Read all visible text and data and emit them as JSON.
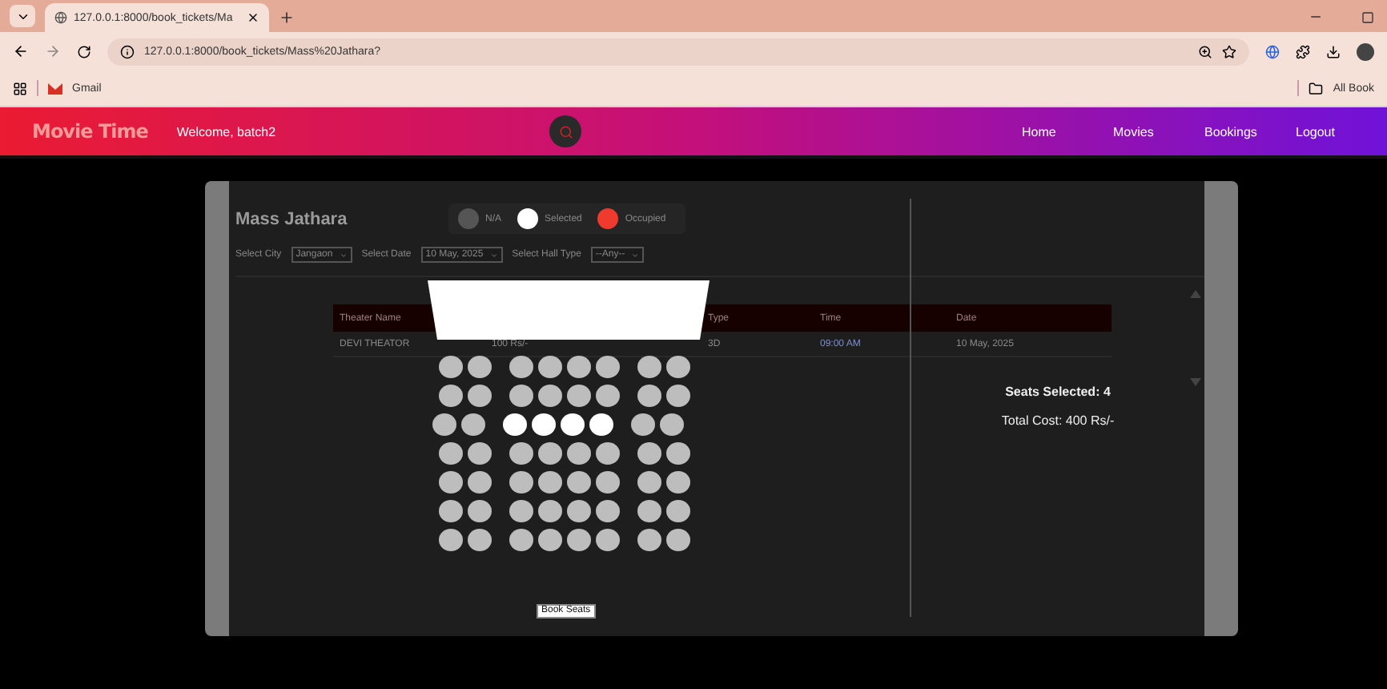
{
  "browser": {
    "tab_title": "127.0.0.1:8000/book_tickets/Ma",
    "address": "127.0.0.1:8000/book_tickets/Mass%20Jathara?",
    "bookmarks": [
      "Gmail"
    ],
    "all_bookmarks": "All Book"
  },
  "navbar": {
    "brand": "Movie Time",
    "welcome": "Welcome, batch2",
    "links": [
      "Home",
      "Movies",
      "Bookings",
      "Logout"
    ]
  },
  "movie": {
    "title": "Mass Jathara"
  },
  "legend": [
    {
      "label": "N/A",
      "color": "#555555"
    },
    {
      "label": "Selected",
      "color": "#ffffff"
    },
    {
      "label": "Occupied",
      "color": "#f03a2e"
    }
  ],
  "filters": [
    {
      "label": "Select City",
      "value": "Jangaon"
    },
    {
      "label": "Select Date",
      "value": "10 May, 2025"
    },
    {
      "label": "Select Hall Type",
      "value": "--Any--"
    }
  ],
  "table": {
    "columns": [
      {
        "label": "Theater Name"
      },
      {},
      {},
      {
        "label": "Type"
      },
      {
        "label": "Time"
      },
      {
        "label": "Date"
      }
    ],
    "rows": [
      {
        "cells": [
          "DEVI THEATOR",
          "100 Rs/-",
          "",
          "3D",
          "09:00 AM",
          "10 May, 2025"
        ]
      }
    ]
  },
  "seat_rows": [
    {
      "seats": [
        {
          "selected": false
        },
        {
          "selected": false
        },
        {
          "selected": false
        },
        {
          "selected": false
        },
        {
          "selected": false
        },
        {
          "selected": false
        },
        {
          "selected": false
        },
        {
          "selected": false
        }
      ]
    },
    {
      "seats": [
        {
          "selected": false
        },
        {
          "selected": false
        },
        {
          "selected": false
        },
        {
          "selected": false
        },
        {
          "selected": false
        },
        {
          "selected": false
        },
        {
          "selected": false
        },
        {
          "selected": false
        }
      ]
    },
    {
      "seats": [
        {
          "selected": false
        },
        {
          "selected": false
        },
        {
          "selected": true
        },
        {
          "selected": true
        },
        {
          "selected": true
        },
        {
          "selected": true
        },
        {
          "selected": false
        },
        {
          "selected": false
        }
      ]
    },
    {
      "seats": [
        {
          "selected": false
        },
        {
          "selected": false
        },
        {
          "selected": false
        },
        {
          "selected": false
        },
        {
          "selected": false
        },
        {
          "selected": false
        },
        {
          "selected": false
        },
        {
          "selected": false
        }
      ]
    },
    {
      "seats": [
        {
          "selected": false
        },
        {
          "selected": false
        },
        {
          "selected": false
        },
        {
          "selected": false
        },
        {
          "selected": false
        },
        {
          "selected": false
        },
        {
          "selected": false
        },
        {
          "selected": false
        }
      ]
    },
    {
      "seats": [
        {
          "selected": false
        },
        {
          "selected": false
        },
        {
          "selected": false
        },
        {
          "selected": false
        },
        {
          "selected": false
        },
        {
          "selected": false
        },
        {
          "selected": false
        },
        {
          "selected": false
        }
      ]
    },
    {
      "seats": [
        {
          "selected": false
        },
        {
          "selected": false
        },
        {
          "selected": false
        },
        {
          "selected": false
        },
        {
          "selected": false
        },
        {
          "selected": false
        },
        {
          "selected": false
        },
        {
          "selected": false
        }
      ]
    }
  ],
  "book_button": "Book Seats",
  "summary": {
    "seats_selected": "Seats Selected: 4",
    "total_cost": "Total Cost: 400 Rs/-"
  }
}
